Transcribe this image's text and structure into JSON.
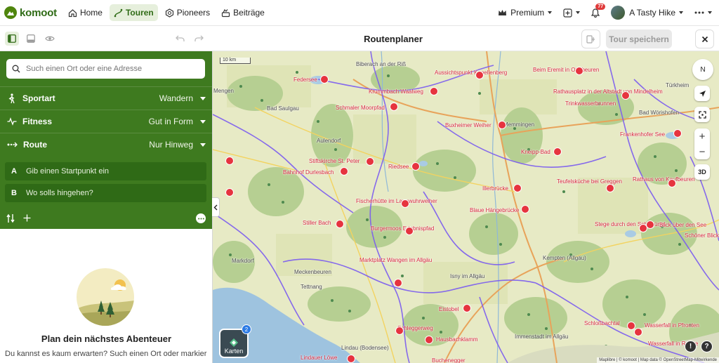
{
  "nav": {
    "logo": "komoot",
    "items": [
      {
        "label": "Home",
        "icon": "home-icon"
      },
      {
        "label": "Touren",
        "icon": "route-icon"
      },
      {
        "label": "Pioneers",
        "icon": "pioneers-icon"
      },
      {
        "label": "Beiträge",
        "icon": "feed-icon"
      }
    ],
    "premium": "Premium",
    "notification_count": "77",
    "user": "A Tasty Hike"
  },
  "subbar": {
    "title": "Routenplaner",
    "save_label": "Tour speichern"
  },
  "planner": {
    "search_placeholder": "Such einen Ort oder eine Adresse",
    "settings": [
      {
        "label": "Sportart",
        "value": "Wandern",
        "icon": "hiker-icon"
      },
      {
        "label": "Fitness",
        "value": "Gut in Form",
        "icon": "pulse-icon"
      },
      {
        "label": "Route",
        "value": "Nur Hinweg",
        "icon": "route-arrow-icon"
      }
    ],
    "waypoints": [
      {
        "letter": "A",
        "text": "Gib einen Startpunkt ein"
      },
      {
        "letter": "B",
        "text": "Wo solls hingehen?"
      }
    ],
    "empty_title": "Plan dein nächstes Abenteuer",
    "empty_text": "Du kannst es kaum erwarten? Such einen Ort oder markier"
  },
  "map": {
    "scale": "10 km",
    "compass": "N",
    "mode_3d": "3D",
    "layers_label": "Karten",
    "layers_badge": "2",
    "attribution": "Maplibre | © komoot | Map data © OpenStreetMap-Mitwirkende",
    "places": [
      {
        "name": "Mengen"
      },
      {
        "name": "Bad Saulgau"
      },
      {
        "name": "Biberach an der Riß"
      },
      {
        "name": "Aulendorf"
      },
      {
        "name": "Memmingen"
      },
      {
        "name": "Türkheim"
      },
      {
        "name": "Bad Wörishofen"
      },
      {
        "name": "Kempten (Allgäu)"
      },
      {
        "name": "Isny im Allgäu"
      },
      {
        "name": "Tettnang"
      },
      {
        "name": "Meckenbeuren"
      },
      {
        "name": "Markdorf"
      },
      {
        "name": "Immenstadt im Allgäu"
      },
      {
        "name": "Lindau (Bodensee)"
      }
    ],
    "pois": [
      {
        "name": "Federsee"
      },
      {
        "name": "Krummbach Waalweg"
      },
      {
        "name": "Schmaler Moorpfad"
      },
      {
        "name": "Aussichtspunkt Kapellenberg"
      },
      {
        "name": "Beim Eremit in Ottobeuren"
      },
      {
        "name": "Rathausplatz in der Altstadt von Mindelheim"
      },
      {
        "name": "Trinkwasserbrunnen"
      },
      {
        "name": "Buxheimer Weiher"
      },
      {
        "name": "Frankenhofer See"
      },
      {
        "name": "Stiftskirche St. Peter"
      },
      {
        "name": "Bahnhof Durlesbach"
      },
      {
        "name": "Riedsee"
      },
      {
        "name": "Kneipp-Bad"
      },
      {
        "name": "Illerbrücke"
      },
      {
        "name": "Teufelsküche bei Greggen"
      },
      {
        "name": "Rathaus von Kaufbeuren"
      },
      {
        "name": "Fischerhütte im Langwuhrweiher"
      },
      {
        "name": "Blaue Hängebrücke"
      },
      {
        "name": "Stiller Bach"
      },
      {
        "name": "Burgermoos Erlebnispfad"
      },
      {
        "name": "Stege durch den Schilfgürtel"
      },
      {
        "name": "Blick über den See"
      },
      {
        "name": "Schöner Blick"
      },
      {
        "name": "Marktplatz Wangen im Allgäu"
      },
      {
        "name": "Eistobel"
      },
      {
        "name": "Schleggerweg"
      },
      {
        "name": "Hausbachklamm"
      },
      {
        "name": "Schloßbachtal"
      },
      {
        "name": "Wasserfall in Pfronten"
      },
      {
        "name": "Wasserfall in Reutte"
      },
      {
        "name": "Lindauer Löwe"
      },
      {
        "name": "Buchenegger"
      }
    ]
  }
}
